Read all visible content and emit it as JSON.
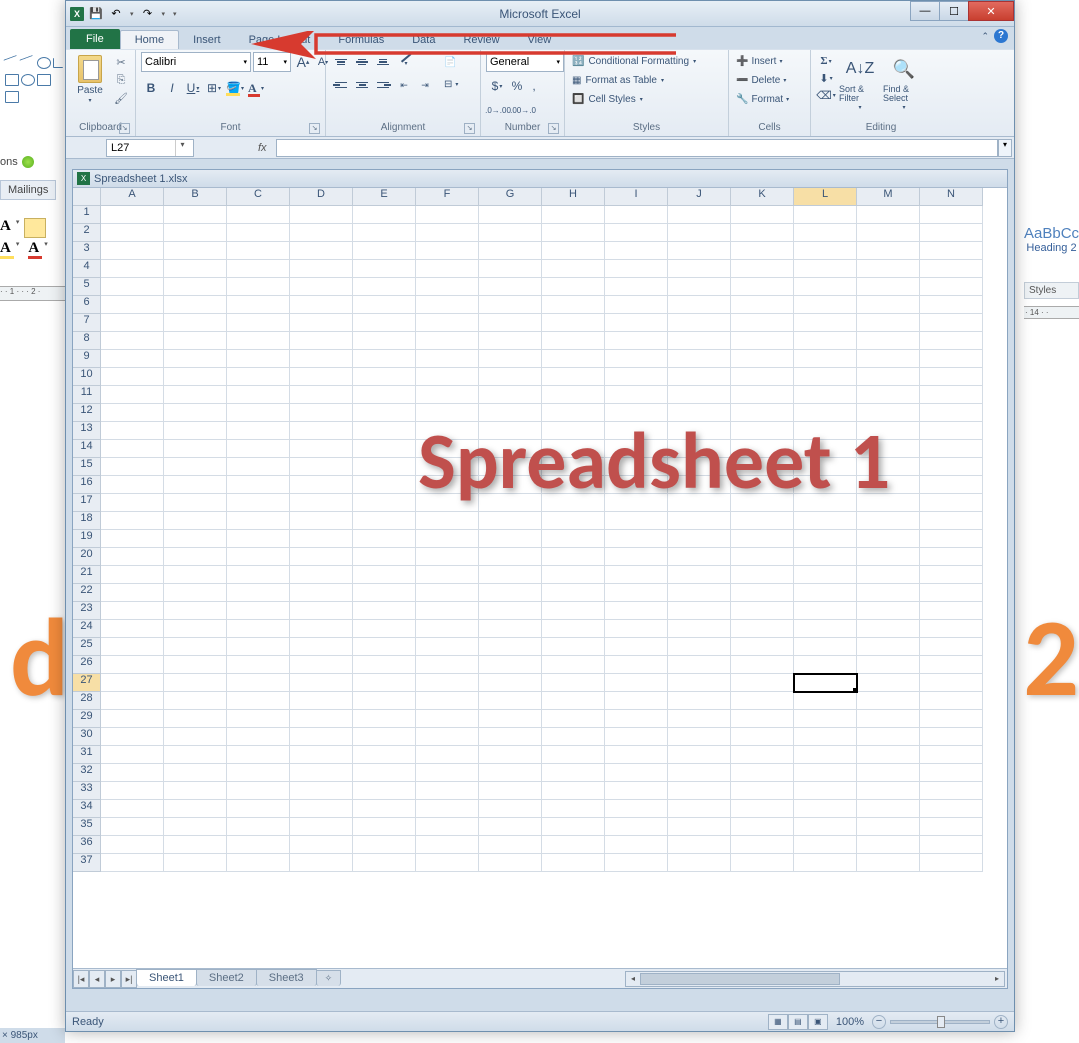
{
  "app_title": "Microsoft Excel",
  "qat": {
    "save": "💾",
    "undo": "↶",
    "redo": "↷"
  },
  "tabs": [
    "File",
    "Home",
    "Insert",
    "Page Layout",
    "Formulas",
    "Data",
    "Review",
    "View"
  ],
  "active_tab": "Home",
  "ribbon": {
    "clipboard": {
      "label": "Clipboard",
      "paste": "Paste",
      "cut": "✂",
      "copy": "⎘",
      "painter": "🖌"
    },
    "font": {
      "label": "Font",
      "name": "Calibri",
      "size": "11",
      "bold": "B",
      "italic": "I",
      "underline": "U",
      "grow": "A",
      "shrink": "A"
    },
    "alignment": {
      "label": "Alignment",
      "wrap": "Wrap Text",
      "merge": "Merge & Center"
    },
    "number": {
      "label": "Number",
      "format": "General",
      "currency": "$",
      "percent": "%",
      "comma": ",",
      "inc": ".00→.0",
      "dec": ".0→.00"
    },
    "styles": {
      "label": "Styles",
      "cond": "Conditional Formatting",
      "table": "Format as Table",
      "cell": "Cell Styles"
    },
    "cells": {
      "label": "Cells",
      "insert": "Insert",
      "delete": "Delete",
      "format": "Format"
    },
    "editing": {
      "label": "Editing",
      "sum": "Σ",
      "fill": "⬇",
      "clear": "⌫",
      "sort": "Sort & Filter",
      "find": "Find & Select"
    }
  },
  "namebox": "L27",
  "formula": "",
  "doc": {
    "name": "Spreadsheet 1.xlsx"
  },
  "columns": [
    "A",
    "B",
    "C",
    "D",
    "E",
    "F",
    "G",
    "H",
    "I",
    "J",
    "K",
    "L",
    "M",
    "N"
  ],
  "active_col": "L",
  "rows": [
    1,
    2,
    3,
    4,
    5,
    6,
    7,
    8,
    9,
    10,
    11,
    12,
    13,
    14,
    15,
    16,
    17,
    18,
    19,
    20,
    21,
    22,
    23,
    24,
    25,
    26,
    27,
    28,
    29,
    30,
    31,
    32,
    33,
    34,
    35,
    36,
    37
  ],
  "active_row": 27,
  "watermark": "Spreadsheet 1",
  "sheets": [
    "Sheet1",
    "Sheet2",
    "Sheet3"
  ],
  "active_sheet": "Sheet1",
  "status": {
    "ready": "Ready",
    "zoom": "100%"
  },
  "bg": {
    "options": "ons",
    "mailings": "Mailings",
    "ruler": "· · 1 · · · 2 ·",
    "heading": "AaBbCc",
    "heading_label": "Heading 2",
    "styles": "Styles",
    "ruler2": "· 14 · ·",
    "d": "d",
    "two": "2",
    "px": "× 985px"
  }
}
